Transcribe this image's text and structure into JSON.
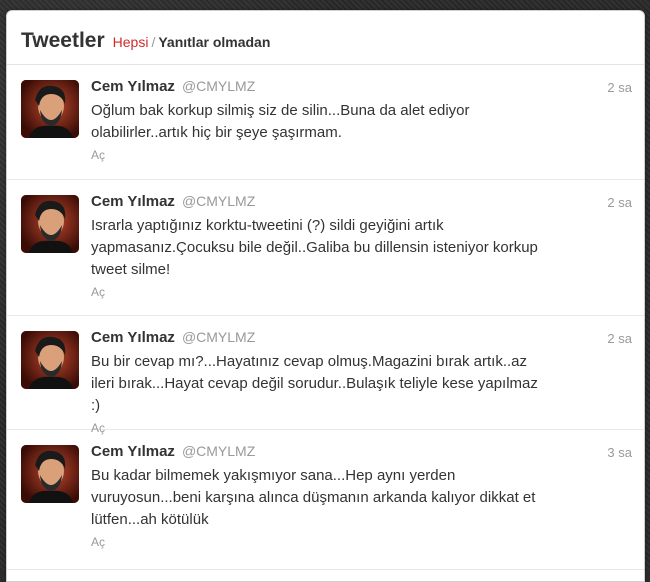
{
  "header": {
    "title": "Tweetler",
    "filter_all": "Hepsi",
    "separator": "/",
    "filter_no_replies": "Yanıtlar olmadan"
  },
  "tweets": [
    {
      "fullname": "Cem Yılmaz",
      "username": "@CMYLMZ",
      "time": "2 sa",
      "text": "Oğlum bak korkup silmiş siz de silin...Buna da alet ediyor olabilirler..artık hiç bir şeye şaşırmam.",
      "expand": "Aç"
    },
    {
      "fullname": "Cem Yılmaz",
      "username": "@CMYLMZ",
      "time": "2 sa",
      "text": "Israrla yaptığınız korktu-tweetini (?) sildi geyiğini artık yapmasanız.Çocuksu bile değil..Galiba bu dillensin isteniyor korkup tweet silme!",
      "expand": "Aç"
    },
    {
      "fullname": "Cem Yılmaz",
      "username": "@CMYLMZ",
      "time": "2 sa",
      "text": "Bu bir cevap mı?...Hayatınız cevap olmuş.Magazini bırak artık..az ileri bırak...Hayat cevap değil sorudur..Bulaşık teliyle kese yapılmaz :)",
      "expand": "Aç"
    },
    {
      "fullname": "Cem Yılmaz",
      "username": "@CMYLMZ",
      "time": "3 sa",
      "text": "Bu kadar bilmemek yakışmıyor sana...Hep aynı yerden vuruyosun...beni karşına alınca düşmanın arkanda kalıyor dikkat et lütfen...ah kötülük",
      "expand": "Aç"
    }
  ]
}
